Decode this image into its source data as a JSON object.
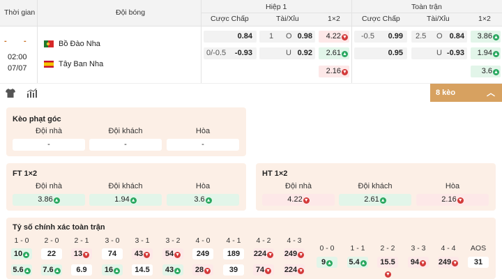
{
  "header": {
    "time": "Thời gian",
    "team": "Đội bóng",
    "half1": "Hiệp 1",
    "fulltime": "Toàn trận",
    "handicap": "Cược Chấp",
    "overunder": "Tài/Xỉu",
    "x12": "1×2"
  },
  "match": {
    "dash": "-",
    "dash2": "-",
    "time": "02:00",
    "date": "07/07",
    "home": "Bồ Đào Nha",
    "away": "Tây Ban Nha",
    "home_flag": "portugal-flag",
    "away_flag": "spain-flag"
  },
  "odds": {
    "h1_hc_home": "0.84",
    "h1_hc_line": "0/-0.5",
    "h1_hc_away": "-0.93",
    "h1_ou_line": "1",
    "h1_ou_o": "O",
    "h1_ou_over": "0.98",
    "h1_ou_u": "U",
    "h1_ou_under": "0.92",
    "h1_1": "4.22",
    "h1_2": "2.61",
    "h1_x": "2.16",
    "ft_hc_line": "-0.5",
    "ft_hc_home": "0.99",
    "ft_hc_away": "0.95",
    "ft_ou_line": "2.5",
    "ft_ou_o": "O",
    "ft_ou_over": "0.84",
    "ft_ou_u": "U",
    "ft_ou_under": "-0.93",
    "ft_1": "3.86",
    "ft_2": "1.94",
    "ft_x": "3.6"
  },
  "toolbar": {
    "more": "8 kèo",
    "shirt_icon": "shirt-icon",
    "chart_icon": "bar-chart-icon"
  },
  "corner": {
    "title": "Kèo phạt góc",
    "home": "Đội nhà",
    "away": "Đội khách",
    "draw": "Hòa",
    "home_val": "-",
    "away_val": "-",
    "draw_val": "-"
  },
  "ft12": {
    "title": "FT 1×2",
    "home": "Đội nhà",
    "away": "Đội khách",
    "draw": "Hòa",
    "home_val": "3.86",
    "away_val": "1.94",
    "draw_val": "3.6"
  },
  "ht12": {
    "title": "HT 1×2",
    "home": "Đội nhà",
    "away": "Đội khách",
    "draw": "Hòa",
    "home_val": "4.22",
    "away_val": "2.61",
    "draw_val": "2.16"
  },
  "correct": {
    "title": "Tỷ số chính xác toàn trận",
    "left_labels": [
      "1 - 0",
      "2 - 0",
      "2 - 1",
      "3 - 0",
      "3 - 1",
      "3 - 2",
      "4 - 0",
      "4 - 1",
      "4 - 2",
      "4 - 3"
    ],
    "row1": [
      "10",
      "22",
      "13",
      "74",
      "43",
      "54",
      "249",
      "189",
      "224",
      "249"
    ],
    "row1_dir": [
      "up",
      "",
      "down",
      "",
      "down",
      "down",
      "",
      "",
      "down",
      "down"
    ],
    "row2": [
      "5.6",
      "7.6",
      "6.9",
      "16",
      "14.5",
      "43",
      "28",
      "39",
      "74",
      "224"
    ],
    "row2_dir": [
      "up",
      "up",
      "",
      "up",
      "",
      "up",
      "down",
      "",
      "down",
      "down"
    ],
    "right_labels": [
      "0 - 0",
      "1 - 1",
      "2 - 2",
      "3 - 3",
      "4 - 4",
      "AOS"
    ],
    "right_vals": [
      "9",
      "5.4",
      "15.5",
      "94",
      "249",
      "31"
    ],
    "right_dir": [
      "up",
      "up",
      "down",
      "down",
      "down",
      ""
    ]
  },
  "colors": {
    "accent": "#d7a160",
    "panel": "#fcefe6",
    "green": "#e2f5e9",
    "red": "#fde8e8"
  }
}
